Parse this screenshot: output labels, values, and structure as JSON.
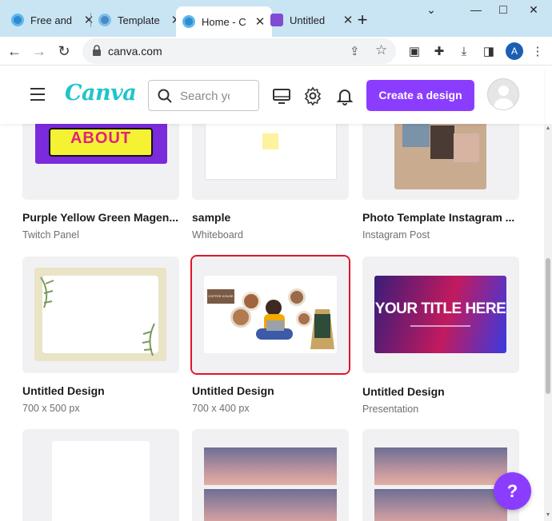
{
  "browser": {
    "tabs": [
      {
        "title": "Free and",
        "favicon": "canva-icon"
      },
      {
        "title": "Template",
        "favicon": "canva-icon"
      },
      {
        "title": "Home - C",
        "favicon": "canva-icon",
        "active": true
      },
      {
        "title": "Untitled",
        "favicon": "canva-design-icon"
      }
    ],
    "url": "canva.com",
    "profile_initial": "A",
    "window_controls": {
      "minimize": "⌄",
      "restore": "—",
      "maximize": "□",
      "close": "✕"
    }
  },
  "header": {
    "logo": "Canva",
    "search_placeholder": "Search yo",
    "create_button": "Create a design"
  },
  "designs": [
    {
      "name": "Purple Yellow Green Magen...",
      "meta": "Twitch Panel",
      "thumb_text": "ABOUT"
    },
    {
      "name": "sample",
      "meta": "Whiteboard"
    },
    {
      "name": "Photo Template Instagram ...",
      "meta": "Instagram Post"
    },
    {
      "name": "Untitled Design",
      "meta": "700 x 500 px"
    },
    {
      "name": "Untitled Design",
      "meta": "700 x 400 px",
      "thumb_text": "COFFEE HOUSE",
      "selected": true
    },
    {
      "name": "Untitled Design",
      "meta": "Presentation",
      "thumb_text": "YOUR TITLE HERE"
    },
    {
      "name": "",
      "meta": ""
    },
    {
      "name": "",
      "meta": ""
    },
    {
      "name": "",
      "meta": ""
    }
  ],
  "help_button": "?",
  "colors": {
    "accent": "#8b3dff",
    "logo": "#20c4cb",
    "selected": "#e0142b",
    "tabstrip": "#c9e4f3"
  }
}
